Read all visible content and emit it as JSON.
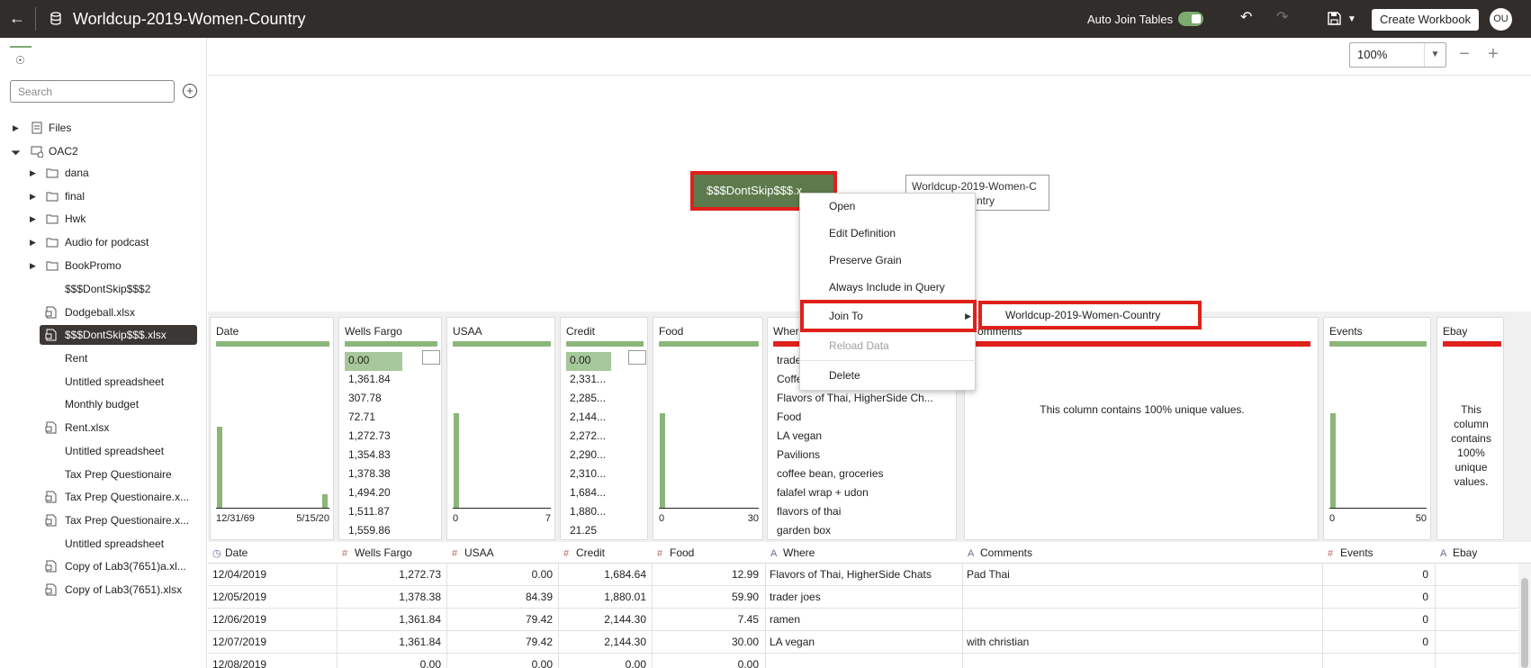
{
  "header": {
    "title": "Worldcup-2019-Women-Country",
    "auto_join_label": "Auto Join Tables",
    "create_workbook_label": "Create Workbook",
    "avatar_initials": "OU"
  },
  "sidebar": {
    "search_placeholder": "Search",
    "items": [
      {
        "label": "Files"
      },
      {
        "label": "OAC2"
      },
      {
        "label": "dana"
      },
      {
        "label": "final"
      },
      {
        "label": "Hwk"
      },
      {
        "label": "Audio for podcast"
      },
      {
        "label": "BookPromo"
      },
      {
        "label": "$$$DontSkip$$$2"
      },
      {
        "label": "Dodgeball.xlsx"
      },
      {
        "label": "$$$DontSkip$$$.xlsx"
      },
      {
        "label": "Rent"
      },
      {
        "label": "Untitled spreadsheet"
      },
      {
        "label": "Monthly budget"
      },
      {
        "label": "Rent.xlsx"
      },
      {
        "label": "Untitled spreadsheet"
      },
      {
        "label": "Tax Prep Questionaire"
      },
      {
        "label": "Tax Prep Questionaire.x..."
      },
      {
        "label": "Tax Prep Questionaire.x..."
      },
      {
        "label": "Untitled spreadsheet"
      },
      {
        "label": "Copy of Lab3(7651)a.xl..."
      },
      {
        "label": "Copy of Lab3(7651).xlsx"
      }
    ]
  },
  "canvas": {
    "zoom": "100%",
    "node_main": "$$$DontSkip$$$.x",
    "node_worldcup_line1": "Worldcup-2019-Women-C",
    "node_worldcup_line2": "ntry"
  },
  "context_menu": {
    "items": [
      "Open",
      "Edit Definition",
      "Preserve Grain",
      "Always Include in Query",
      "Join To",
      "Reload Data",
      "Delete"
    ],
    "submenu_item": "Worldcup-2019-Women-Country"
  },
  "profile": {
    "date": {
      "title": "Date",
      "min": "12/31/69",
      "max": "5/15/20"
    },
    "wells": {
      "title": "Wells Fargo",
      "values": [
        "0.00",
        "1,361.84",
        "307.78",
        "72.71",
        "1,272.73",
        "1,354.83",
        "1,378.38",
        "1,494.20",
        "1,511.87",
        "1,559.86"
      ]
    },
    "usaa": {
      "title": "USAA",
      "min": "0",
      "max": "7"
    },
    "credit": {
      "title": "Credit",
      "values": [
        "0.00",
        "2,331...",
        "2,285...",
        "2,144...",
        "2,272...",
        "2,290...",
        "2,310...",
        "1,684...",
        "1,880...",
        "21.25"
      ]
    },
    "food": {
      "title": "Food",
      "min": "0",
      "max": "30"
    },
    "where": {
      "title": "Wher",
      "values": [
        "trade",
        "Coffe",
        "Flavors of Thai, HigherSide Ch...",
        "Food",
        "LA vegan",
        "Pavilions",
        "coffee bean, groceries",
        "falafel wrap + udon",
        "flavors of thai",
        "garden box"
      ]
    },
    "comments": {
      "title": "omments",
      "unique_text": "This column contains 100% unique values."
    },
    "events": {
      "title": "Events",
      "min": "0",
      "max": "50"
    },
    "ebay": {
      "title": "Ebay",
      "unique_text": "This column contains 100% unique values."
    }
  },
  "grid": {
    "headers": [
      "Date",
      "Wells Fargo",
      "USAA",
      "Credit",
      "Food",
      "Where",
      "Comments",
      "Events",
      "Ebay"
    ],
    "rows": [
      [
        "12/04/2019",
        "1,272.73",
        "0.00",
        "1,684.64",
        "12.99",
        "Flavors of Thai, HigherSide Chats",
        "Pad Thai",
        "0",
        ""
      ],
      [
        "12/05/2019",
        "1,378.38",
        "84.39",
        "1,880.01",
        "59.90",
        "trader joes",
        "",
        "0",
        ""
      ],
      [
        "12/06/2019",
        "1,361.84",
        "79.42",
        "2,144.30",
        "7.45",
        "ramen",
        "",
        "0",
        ""
      ],
      [
        "12/07/2019",
        "1,361.84",
        "79.42",
        "2,144.30",
        "30.00",
        "LA vegan",
        "with christian",
        "0",
        ""
      ],
      [
        "12/08/2019",
        "0.00",
        "0.00",
        "0.00",
        "0.00",
        "",
        "",
        "",
        ""
      ]
    ]
  },
  "colors": {
    "header_bg": "#312d2a",
    "accent_green": "#7bab6f",
    "node_green": "#5d7a4c",
    "highlight_red": "#e0201b"
  }
}
